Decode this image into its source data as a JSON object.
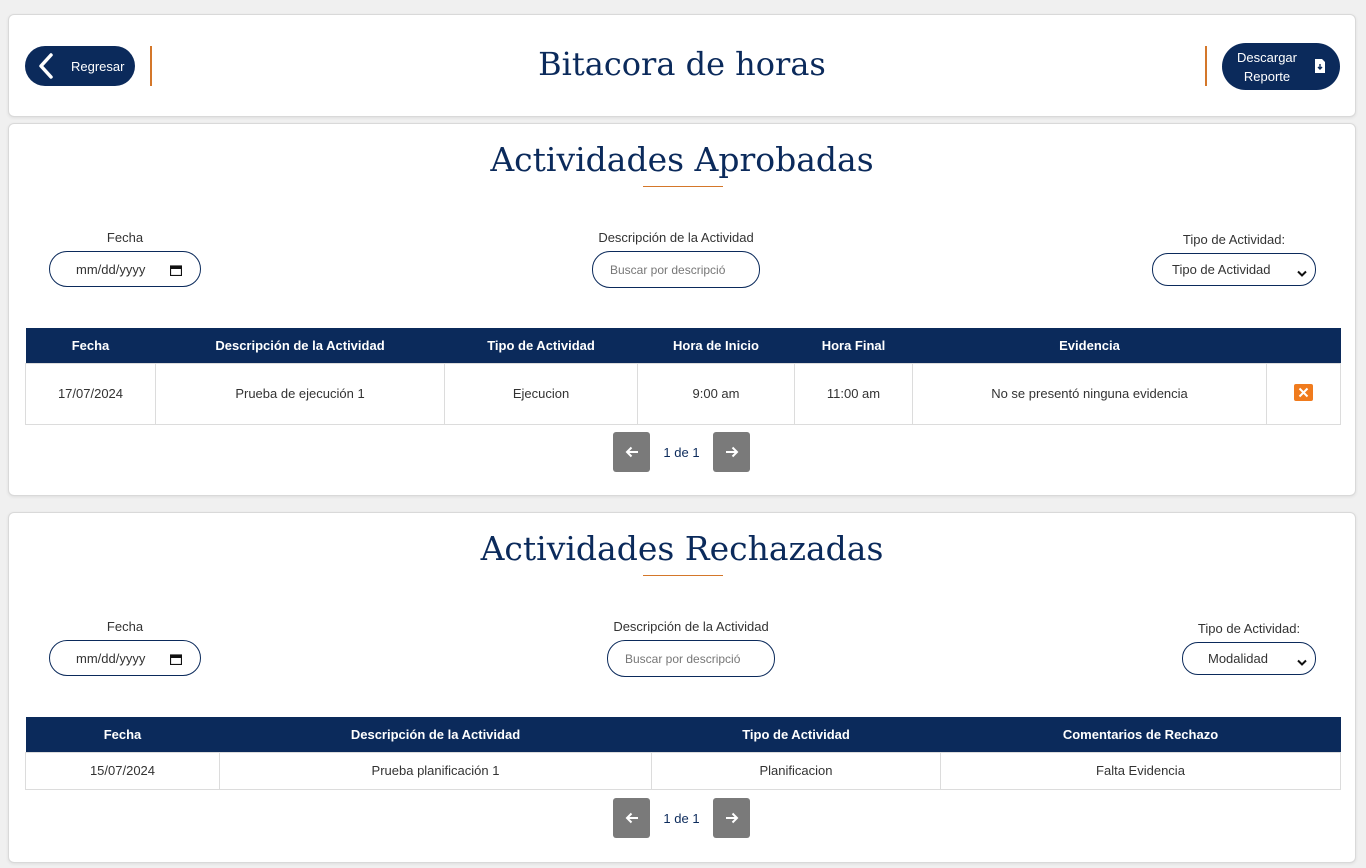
{
  "header": {
    "back_label": "Regresar",
    "title": "Bitacora de horas",
    "download_label": "Descargar Reporte"
  },
  "approved": {
    "title": "Actividades Aprobadas",
    "filters": {
      "date_label": "Fecha",
      "date_placeholder": "mm/dd/yyyy",
      "desc_label": "Descripción de la Actividad",
      "desc_placeholder": "Buscar por descripció",
      "type_label": "Tipo de Actividad:",
      "type_selected": "Tipo de Actividad"
    },
    "columns": [
      "Fecha",
      "Descripción de la Actividad",
      "Tipo de Actividad",
      "Hora de Inicio",
      "Hora Final",
      "Evidencia"
    ],
    "rows": [
      {
        "fecha": "17/07/2024",
        "descripcion": "Prueba de ejecución 1",
        "tipo": "Ejecucion",
        "inicio": "9:00 am",
        "final": "11:00 am",
        "evidencia": "No se presentó ninguna evidencia"
      }
    ],
    "pager": "1 de 1"
  },
  "rejected": {
    "title": "Actividades Rechazadas",
    "filters": {
      "date_label": "Fecha",
      "date_placeholder": "mm/dd/yyyy",
      "desc_label": "Descripción de la Actividad",
      "desc_placeholder": "Buscar por descripció",
      "type_label": "Tipo de Actividad:",
      "type_selected": "Modalidad"
    },
    "columns": [
      "Fecha",
      "Descripción de la Actividad",
      "Tipo de Actividad",
      "Comentarios de Rechazo"
    ],
    "rows": [
      {
        "fecha": "15/07/2024",
        "descripcion": "Prueba planificación 1",
        "tipo": "Planificacion",
        "comentarios": "Falta Evidencia"
      }
    ],
    "pager": "1 de 1"
  },
  "colors": {
    "primary": "#0b2a5b",
    "accent": "#d4772a",
    "delete": "#f07b1d",
    "pager_button": "#7a7a7a"
  },
  "icons": {
    "back": "chevron-left-icon",
    "download": "file-download-icon",
    "calendar": "calendar-icon",
    "select": "chevron-down-icon",
    "delete": "close-icon",
    "prev": "arrow-left-icon",
    "next": "arrow-right-icon"
  }
}
